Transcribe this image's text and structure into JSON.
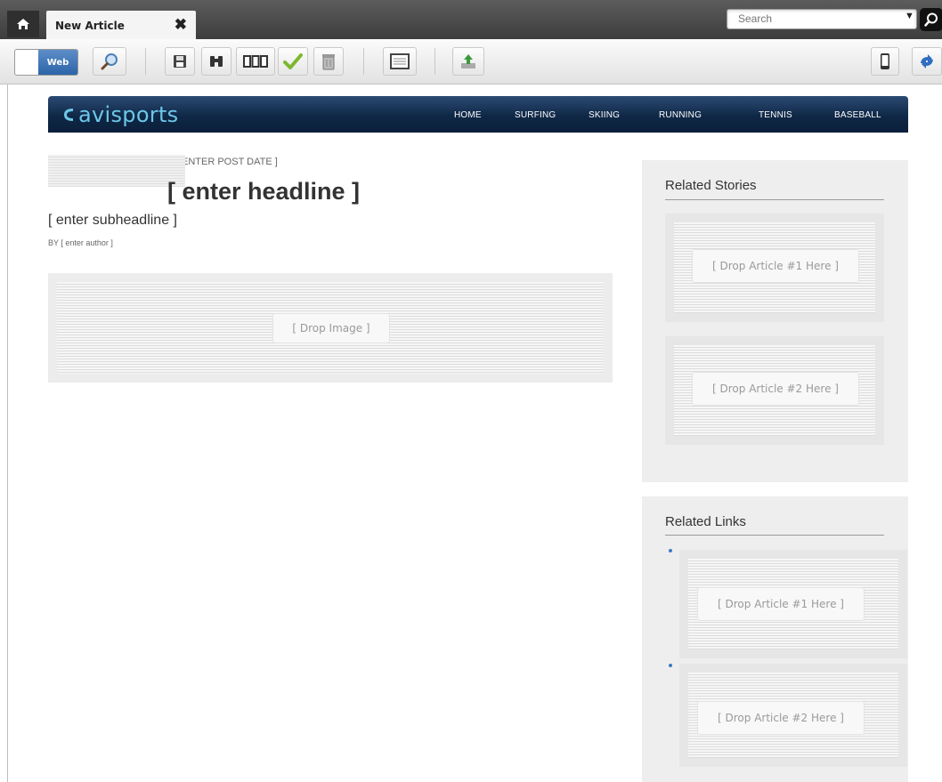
{
  "browser": {
    "tab_title": "New Article",
    "tab_close": "✖",
    "search_placeholder": "Search",
    "search_dropdown": "▼"
  },
  "toolbar": {
    "mode_label": "Web"
  },
  "site": {
    "logo_text": "avisports",
    "nav": [
      "HOME",
      "SURFING",
      "SKIING",
      "RUNNING",
      "TENNIS",
      "BASEBALL"
    ]
  },
  "article": {
    "post_date": "ENTER POST DATE ]",
    "headline": "[ enter headline ]",
    "subheadline": "[ enter subheadline ]",
    "byline": "BY [ enter author ]",
    "image_drop": "[ Drop Image ]"
  },
  "sidebar": {
    "related_stories": {
      "title": "Related Stories",
      "slots": [
        "[ Drop Article #1 Here ]",
        "[ Drop Article #2 Here ]"
      ]
    },
    "related_links": {
      "title": "Related Links",
      "slots": [
        "[ Drop Article #1 Here ]",
        "[ Drop Article #2 Here ]"
      ]
    }
  }
}
